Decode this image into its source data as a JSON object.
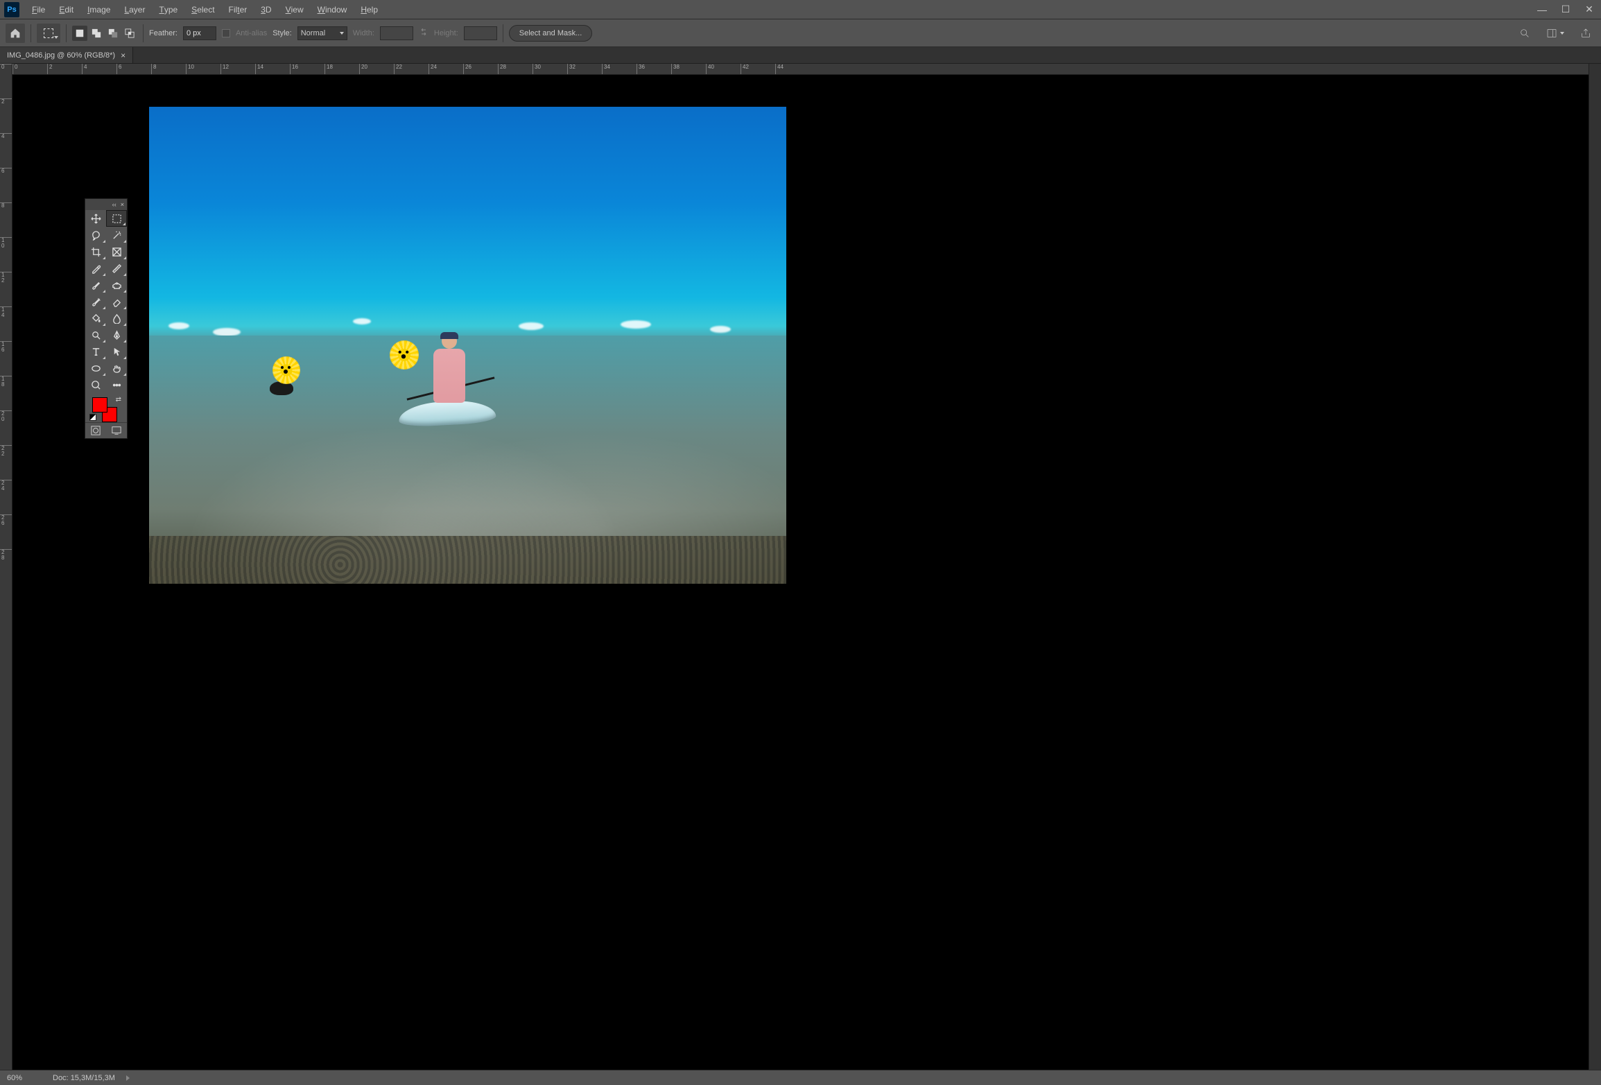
{
  "app": {
    "logo_text": "Ps"
  },
  "menu": {
    "items": [
      {
        "label": "File",
        "ul": "F"
      },
      {
        "label": "Edit",
        "ul": "E"
      },
      {
        "label": "Image",
        "ul": "I"
      },
      {
        "label": "Layer",
        "ul": "L"
      },
      {
        "label": "Type",
        "ul": "T"
      },
      {
        "label": "Select",
        "ul": "S"
      },
      {
        "label": "Filter",
        "ul": "t"
      },
      {
        "label": "3D",
        "ul": "3"
      },
      {
        "label": "View",
        "ul": "V"
      },
      {
        "label": "Window",
        "ul": "W"
      },
      {
        "label": "Help",
        "ul": "H"
      }
    ]
  },
  "window_controls": {
    "minimize": "—",
    "maximize": "☐",
    "close": "✕"
  },
  "options": {
    "feather_label": "Feather:",
    "feather_value": "0 px",
    "anti_alias_label": "Anti-alias",
    "anti_alias_checked": false,
    "style_label": "Style:",
    "style_value": "Normal",
    "width_label": "Width:",
    "width_value": "",
    "height_label": "Height:",
    "height_value": "",
    "select_mask_label": "Select and Mask..."
  },
  "tabs": [
    {
      "title": "IMG_0486.jpg @ 60% (RGB/8*)",
      "active": true
    }
  ],
  "status": {
    "zoom": "60%",
    "doc_label": "Doc:",
    "doc_value": "15,3M/15,3M"
  },
  "ruler_h": [
    0,
    2,
    4,
    6,
    8,
    10,
    12,
    14,
    16,
    18,
    20,
    22,
    24,
    26,
    28,
    30,
    32,
    34,
    36,
    38,
    40,
    42,
    44
  ],
  "ruler_v": [
    0,
    2,
    4,
    6,
    8,
    10,
    12,
    14,
    16,
    18,
    20,
    22,
    24,
    26,
    28
  ],
  "toolbox": {
    "foreground_color": "#ff0000",
    "background_color": "#ff0000",
    "tools": [
      "move-tool",
      "marquee-tool",
      "lasso-tool",
      "magic-wand-tool",
      "crop-tool",
      "frame-tool",
      "eyedropper-tool",
      "ruler-angle-tool",
      "brush-tool",
      "clone-stamp-tool",
      "history-brush-tool",
      "eraser-tool",
      "paint-bucket-tool",
      "blur-tool",
      "dodge-tool",
      "pen-tool",
      "type-tool",
      "path-select-tool",
      "shape-tool",
      "hand-tool",
      "zoom-tool",
      "more-tools"
    ],
    "active_tool": "marquee-tool"
  },
  "icons": {
    "home": "home-icon",
    "marquee": "marquee-icon",
    "search": "search-icon",
    "workspace_switcher": "workspace-switcher-icon",
    "share": "share-icon",
    "swap_size": "swap-wh-icon",
    "panel_collapse": "collapse-icon",
    "panel_close": "close-icon",
    "quickmask": "quick-mask-icon",
    "screenmode": "screen-mode-icon"
  }
}
